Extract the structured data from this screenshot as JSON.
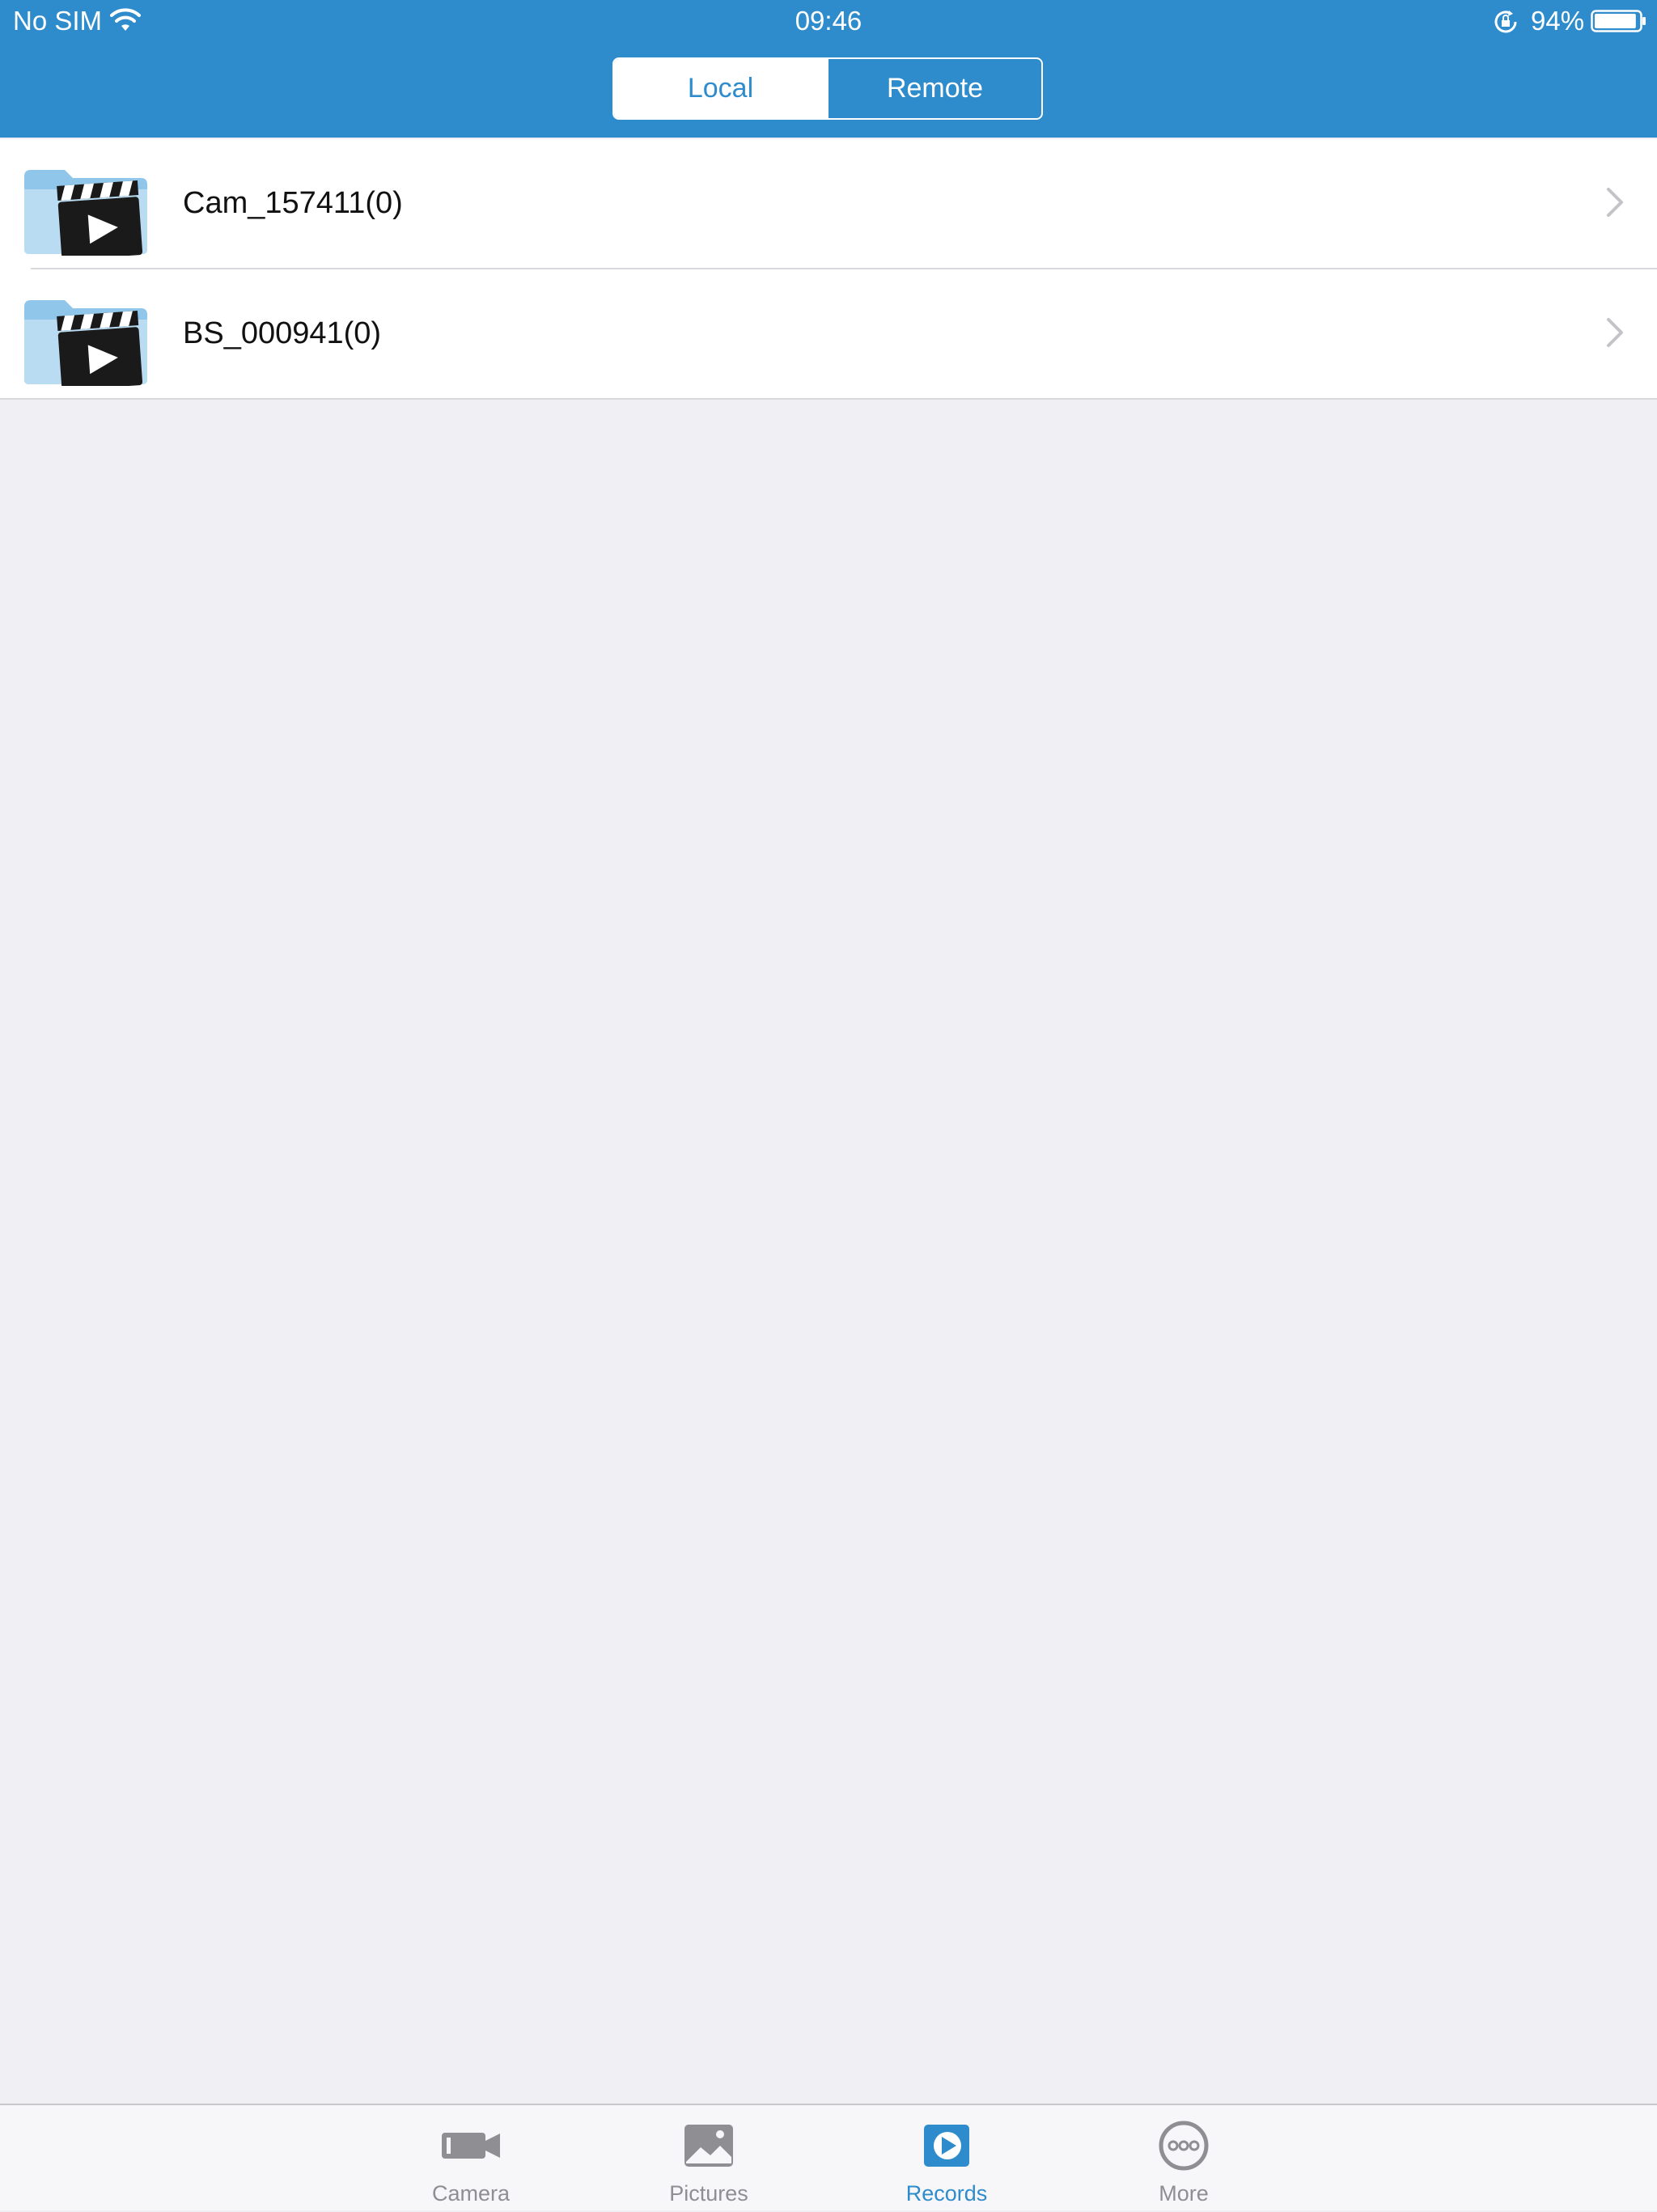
{
  "status_bar": {
    "carrier": "No SIM",
    "time": "09:46",
    "battery_percent": "94%",
    "battery_level": 0.94
  },
  "segmented_control": {
    "options": [
      {
        "label": "Local",
        "selected": true
      },
      {
        "label": "Remote",
        "selected": false
      }
    ]
  },
  "folders": [
    {
      "name": "Cam_157411(0)",
      "icon": "video-folder-icon"
    },
    {
      "name": "BS_000941(0)",
      "icon": "video-folder-icon"
    }
  ],
  "tab_bar": {
    "tabs": [
      {
        "label": "Camera",
        "icon": "camera-icon",
        "active": false
      },
      {
        "label": "Pictures",
        "icon": "pictures-icon",
        "active": false
      },
      {
        "label": "Records",
        "icon": "records-icon",
        "active": true
      },
      {
        "label": "More",
        "icon": "more-icon",
        "active": false
      }
    ]
  },
  "colors": {
    "accent": "#2e8ccd",
    "background": "#efeff4",
    "inactive": "#8e8e93"
  }
}
